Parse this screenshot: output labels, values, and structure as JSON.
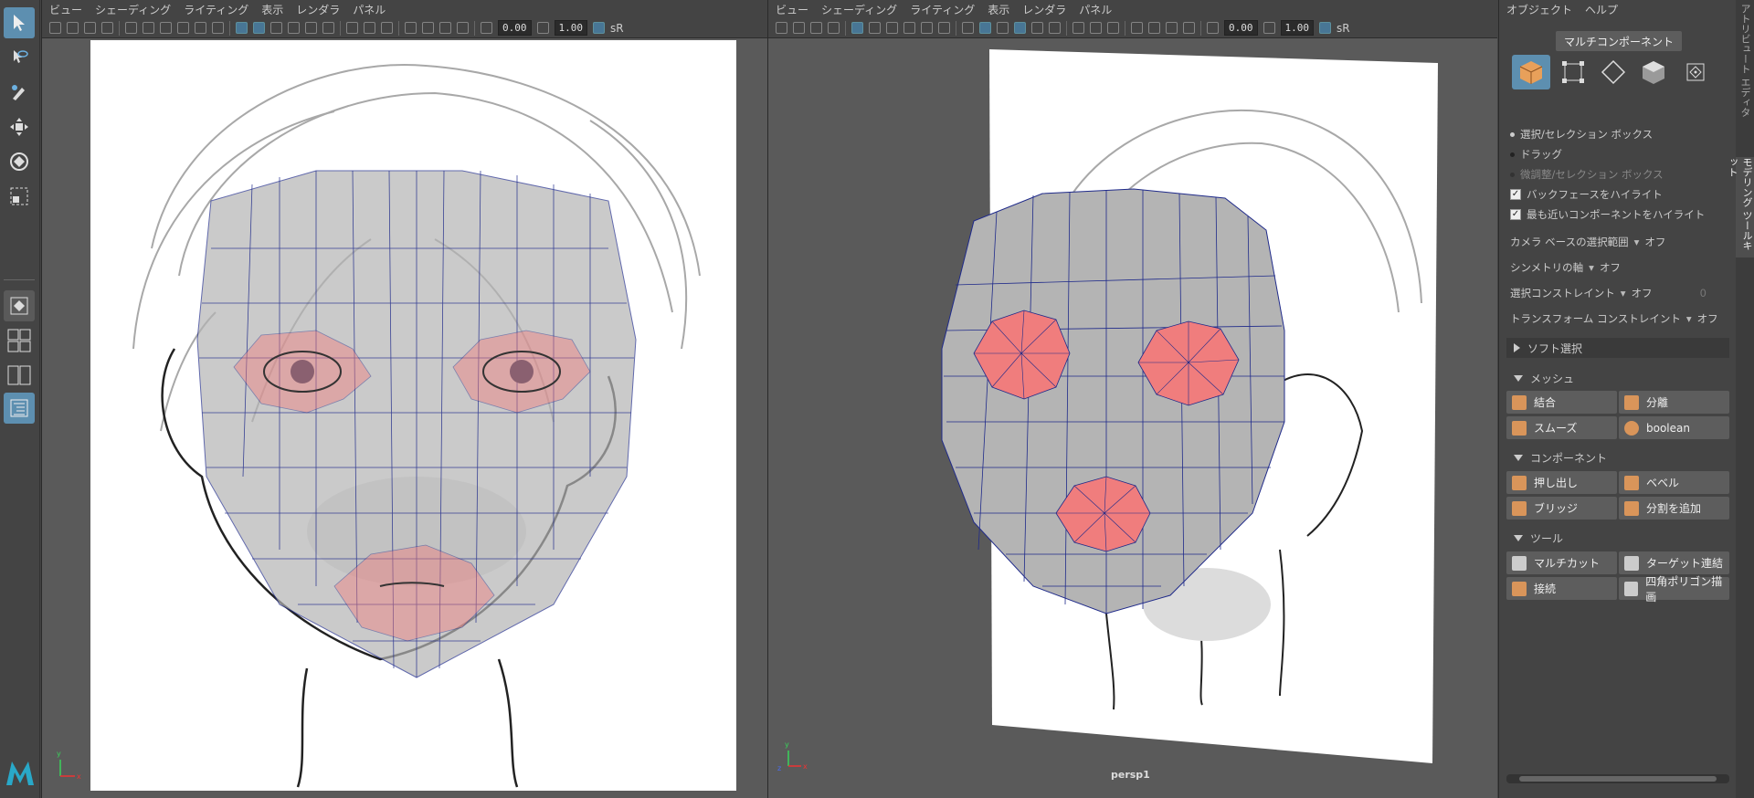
{
  "viewport_menu": [
    "ビュー",
    "シェーディング",
    "ライティング",
    "表示",
    "レンダラ",
    "パネル"
  ],
  "viewport_left": {
    "near": "0.00",
    "far": "1.00",
    "srgb": "sR"
  },
  "viewport_right": {
    "near": "0.00",
    "far": "1.00",
    "srgb": "sR",
    "camera_label": "persp1"
  },
  "toolbox_icons": [
    "select-tool-icon",
    "lasso-tool-icon",
    "paint-select-tool-icon",
    "move-tool-icon",
    "rotate-tool-icon",
    "scale-tool-icon",
    "layout-single-icon",
    "layout-four-icon",
    "layout-two-icon",
    "outliner-icon",
    "maya-logo-icon"
  ],
  "mtk": {
    "menu": [
      "オブジェクト",
      "ヘルプ"
    ],
    "multi_component": "マルチコンポーネント",
    "component_icons": [
      "object-mode-icon",
      "vertex-mode-icon",
      "edge-mode-icon",
      "face-mode-icon",
      "uv-mode-icon"
    ],
    "selection_options": [
      {
        "label": "選択/セレクション ボックス",
        "kind": "radio",
        "state": "on"
      },
      {
        "label": "ドラッグ",
        "kind": "radio",
        "state": "off"
      },
      {
        "label": "微調整/セレクション ボックス",
        "kind": "radio",
        "state": "disabled"
      },
      {
        "label": "バックフェースをハイライト",
        "kind": "check",
        "state": "on"
      },
      {
        "label": "最も近いコンポーネントをハイライト",
        "kind": "check",
        "state": "on"
      }
    ],
    "dropdowns": [
      {
        "label": "カメラ ベースの選択範囲",
        "value": "オフ"
      },
      {
        "label": "シンメトリの軸",
        "value": "オフ"
      },
      {
        "label": "選択コンストレイント",
        "value": "オフ",
        "extra": "0"
      },
      {
        "label": "トランスフォーム コンストレイント",
        "value": "オフ"
      }
    ],
    "soft_select": "ソフト選択",
    "sections": [
      {
        "title": "メッシュ",
        "buttons": [
          "結合",
          "分離",
          "スムーズ",
          "boolean"
        ]
      },
      {
        "title": "コンポーネント",
        "buttons": [
          "押し出し",
          "ベベル",
          "ブリッジ",
          "分割を追加"
        ]
      },
      {
        "title": "ツール",
        "buttons": [
          "マルチカット",
          "ターゲット連結",
          "接続",
          "四角ポリゴン描画"
        ]
      }
    ],
    "side_tabs": [
      "アトリビュート エディタ",
      "モデリング ツールキット"
    ]
  },
  "colors": {
    "accent": "#5d8fb0",
    "mesh_face": "#b4b4b4",
    "mesh_wire": "#1f2a8a",
    "selected_face": "#f07d7d"
  }
}
